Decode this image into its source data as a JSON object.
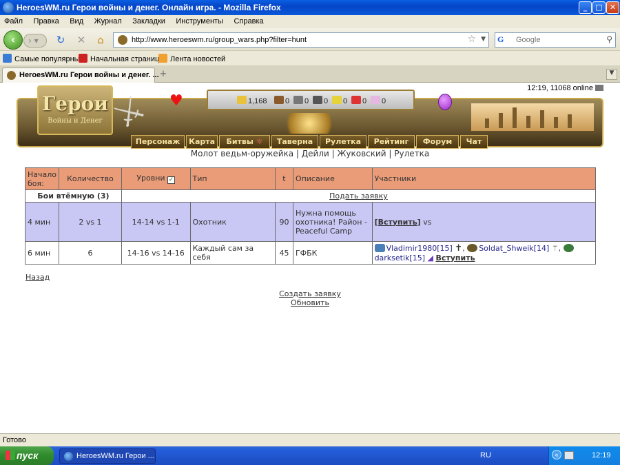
{
  "window": {
    "title": "HeroesWM.ru Герои войны и денег. Онлайн игра. - Mozilla Firefox",
    "buttons": [
      "_",
      "□",
      "✕"
    ]
  },
  "menu": [
    "Файл",
    "Правка",
    "Вид",
    "Журнал",
    "Закладки",
    "Инструменты",
    "Справка"
  ],
  "nav": {
    "url": "http://www.heroeswm.ru/group_wars.php?filter=hunt",
    "search_placeholder": "Google"
  },
  "bookmarks": [
    "Самые популярные",
    "Начальная страница",
    "Лента новостей"
  ],
  "tab": {
    "label": "HeroesWM.ru Герои войны и денег. ..."
  },
  "game": {
    "logo_title": "Герои",
    "logo_sub": "Войны и Денег",
    "time_online": "12:19, 11068 online",
    "resources": [
      "1,168",
      "0",
      "0",
      "0",
      "0",
      "0",
      "0"
    ],
    "nav": [
      "Персонаж",
      "Карта",
      "Битвы",
      "Таверна",
      "Рулетка",
      "Рейтинг",
      "Форум",
      "Чат"
    ],
    "sublinks": [
      "Молот ведьм-оружейка",
      "Дейли",
      "Жуковский",
      "Рулетка"
    ]
  },
  "table": {
    "headers": {
      "start": "Начало боя:",
      "count": "Количество",
      "levels": "Уровни",
      "type": "Тип",
      "t": "t",
      "desc": "Описание",
      "participants": "Участники"
    },
    "group": {
      "title": "Бои втёмную (3)",
      "submit": "Подать заявку"
    },
    "rows": [
      {
        "start": "4 мин",
        "count": "2 vs 1",
        "levels": "14-14 vs 1-1",
        "type": "Охотник",
        "t": "90",
        "desc": "Нужна помощь охотника! Район - Peaceful Camp",
        "join": "[Вступить]",
        "vs": "vs"
      },
      {
        "start": "6 мин",
        "count": "6",
        "levels": "14-16 vs 14-16",
        "type": "Каждый сам за себя",
        "t": "45",
        "desc": "ГФБК",
        "p1": "Vladimir1980[15]",
        "p2": "Soldat_Shweik[14]",
        "p3": "darksetik[15]",
        "join": "Вступить"
      }
    ]
  },
  "links": {
    "back": "Назад",
    "create": "Создать заявку",
    "refresh": "Обновить"
  },
  "status": "Готово",
  "taskbar": {
    "start": "пуск",
    "item": "HeroesWM.ru Герои ...",
    "lang": "RU",
    "clock": "12:19"
  }
}
